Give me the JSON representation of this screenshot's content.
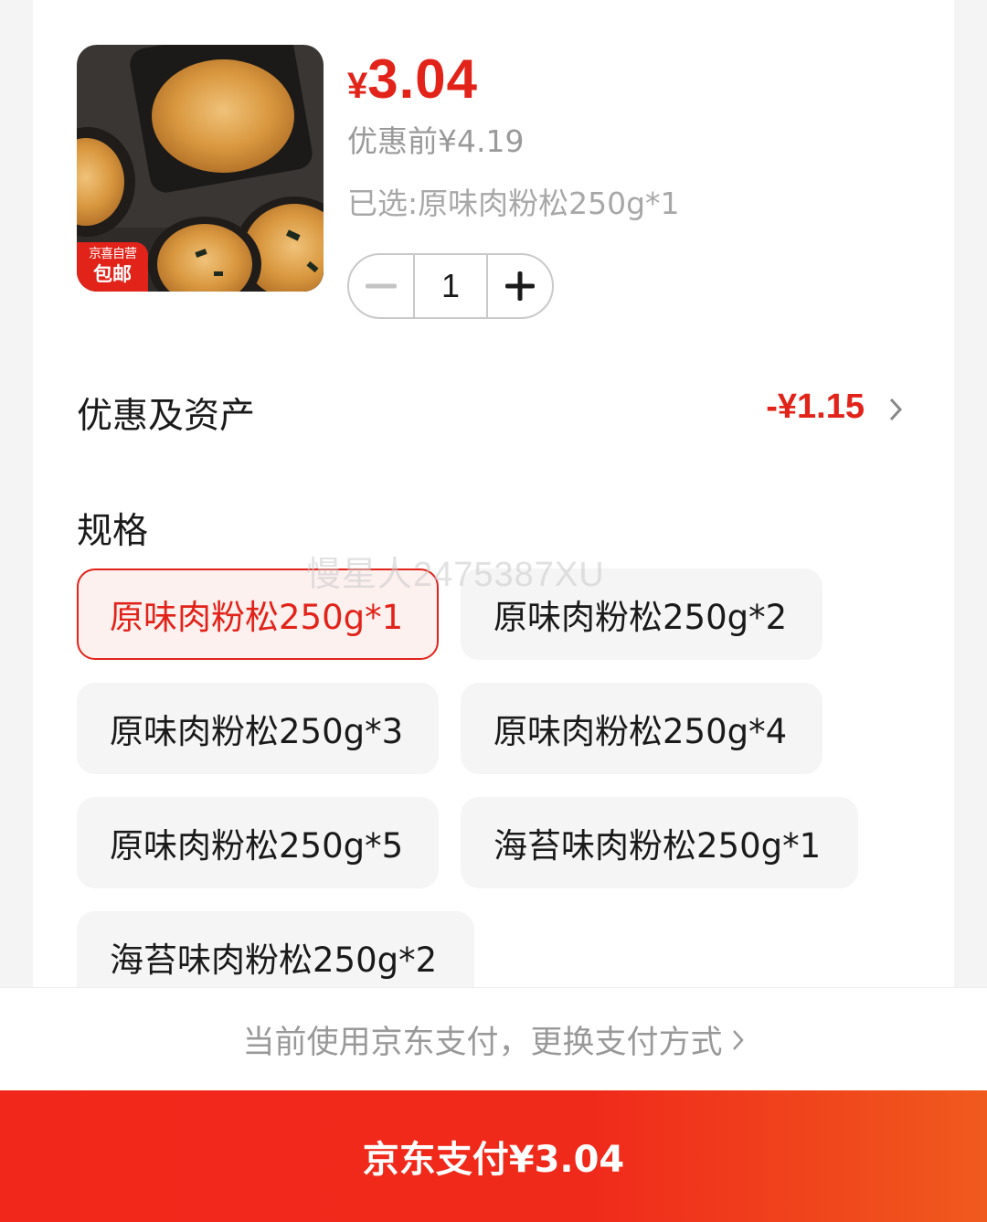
{
  "product": {
    "badge_top": "京喜自营",
    "badge_bottom": "包邮",
    "price_currency": "¥",
    "price_value": "3.04",
    "original_price": "优惠前¥4.19",
    "selected": "已选:原味肉粉松250g*1",
    "quantity": "1"
  },
  "discount": {
    "title": "优惠及资产",
    "amount": "-¥1.15"
  },
  "specs": {
    "title": "规格",
    "options": [
      "原味肉粉松250g*1",
      "原味肉粉松250g*2",
      "原味肉粉松250g*3",
      "原味肉粉松250g*4",
      "原味肉粉松250g*5",
      "海苔味肉粉松250g*1",
      "海苔味肉粉松250g*2"
    ],
    "selected_index": 0
  },
  "watermark": "慢星人2475387XU",
  "payment": {
    "method_text": "当前使用京东支付，更换支付方式",
    "button_label": "京东支付¥3.04"
  },
  "colors": {
    "accent": "#e2231a",
    "button_gradient_end": "#f05a1d"
  }
}
